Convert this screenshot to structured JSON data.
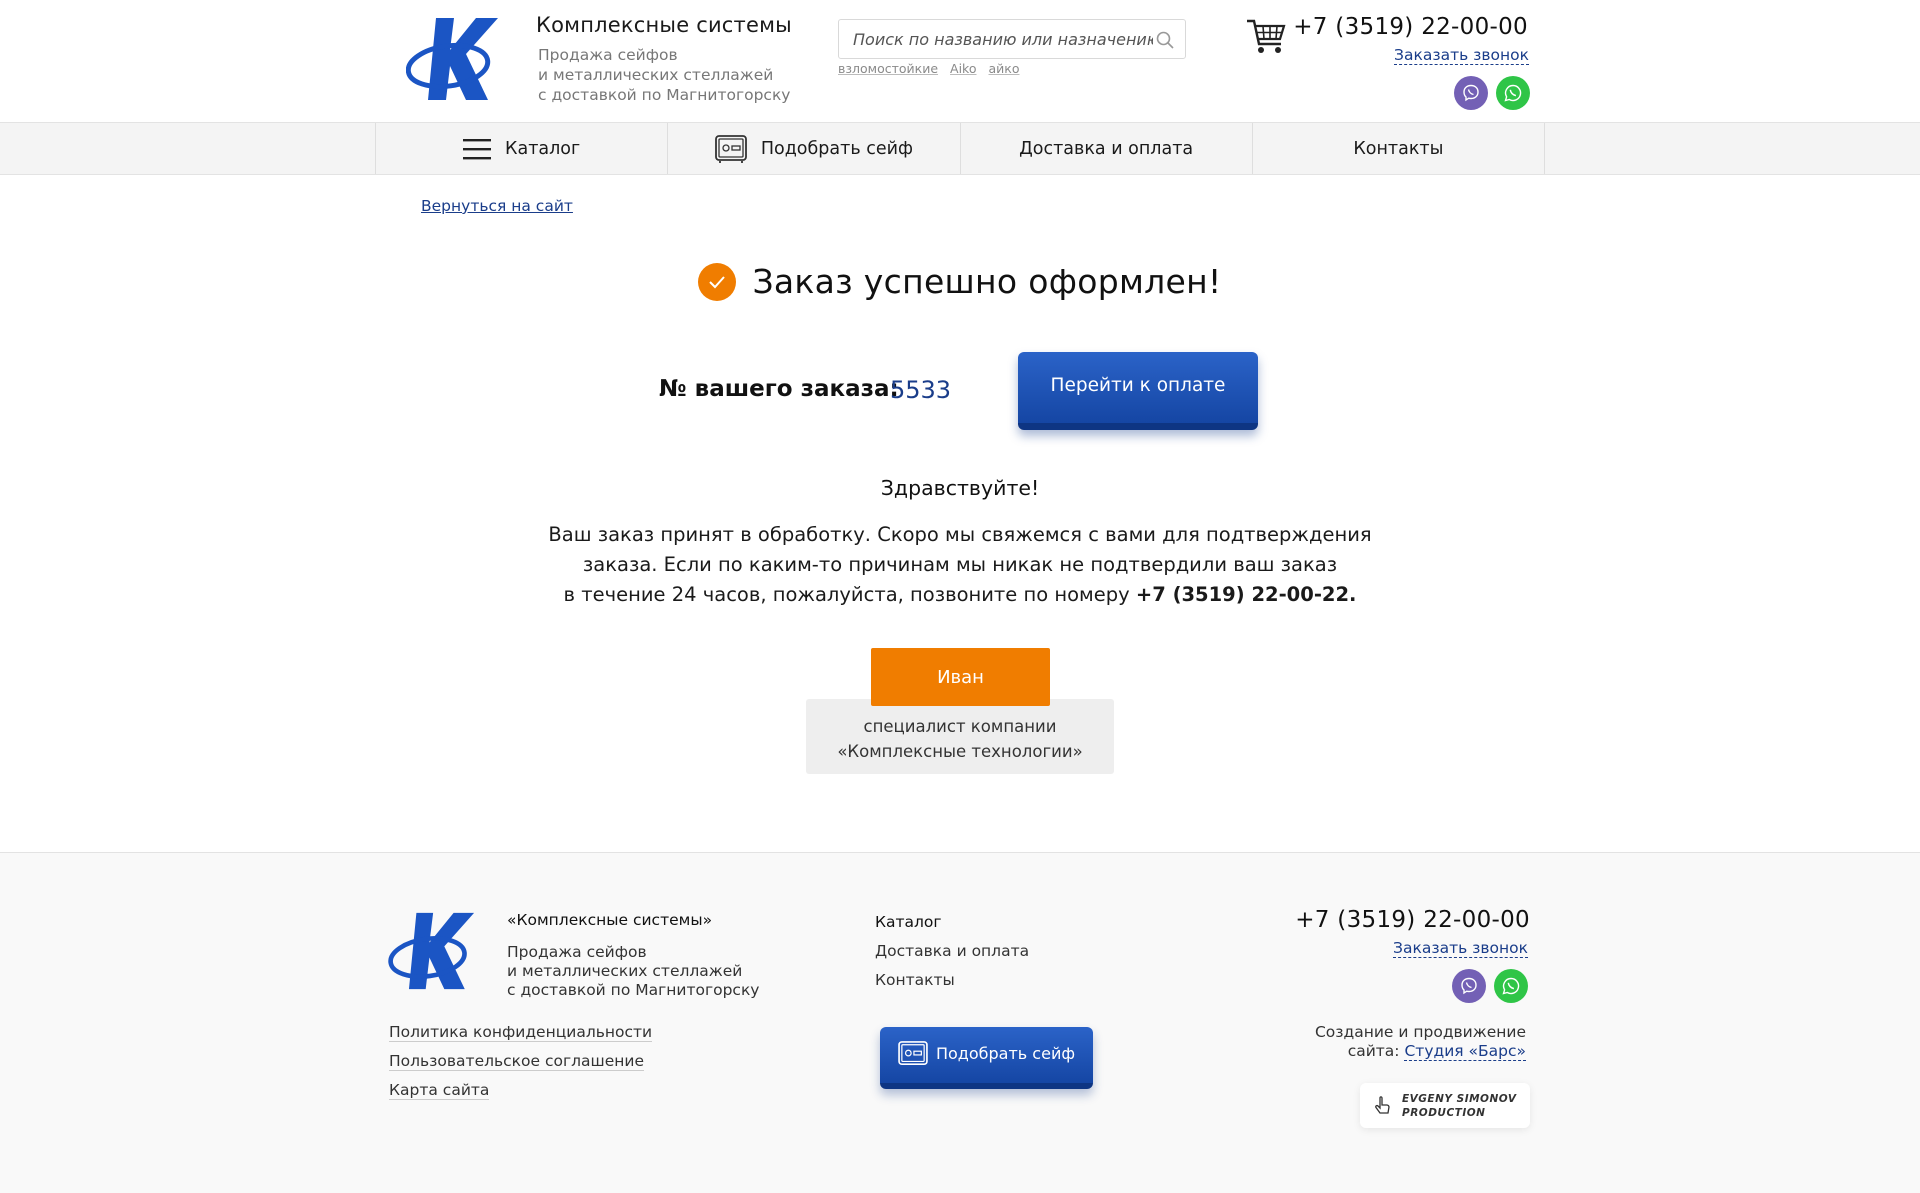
{
  "header": {
    "brand_title": "Комплексные системы",
    "brand_sub": [
      "Продажа сейфов",
      "и металлических стеллажей",
      "с доставкой по Магнитогорску"
    ],
    "search_placeholder": "Поиск по названию или назначению",
    "search_hints": [
      "взломостойкие",
      "Aiko",
      "айко"
    ],
    "phone": "+7 (3519) 22-00-00",
    "callback": "Заказать звонок",
    "icons": {
      "cart": "cart-icon",
      "search": "search-icon",
      "viber": "viber-icon",
      "whatsapp": "whatsapp-icon"
    }
  },
  "nav": {
    "items": [
      {
        "label": "Каталог",
        "icon": "menu-icon"
      },
      {
        "label": "Подобрать сейф",
        "icon": "safe-icon"
      },
      {
        "label": "Доставка и оплата",
        "icon": ""
      },
      {
        "label": "Контакты",
        "icon": ""
      }
    ]
  },
  "main": {
    "back_link": "Вернуться на сайт",
    "success_title": "Заказ успешно оформлен!",
    "order_label": "№ вашего заказа:",
    "order_number": "5533",
    "pay_button": "Перейти к оплате",
    "greeting": "Здравствуйте!",
    "info_lines": [
      "Ваш заказ принят в обработку. Скоро мы свяжемся с вами для подтверждения",
      "заказа. Если по каким-то причинам мы никак не подтвердили ваш заказ",
      "в течение 24 часов, пожалуйста, позвоните по номеру "
    ],
    "info_phone": "+7 (3519) 22-00-22.",
    "manager_name": "Иван",
    "manager_desc": [
      "специалист компании",
      "«Комплексные технологии»"
    ]
  },
  "footer": {
    "brand": "«Комплексные системы»",
    "brand_sub": [
      "Продажа сейфов",
      "и металлических стеллажей",
      "с доставкой по Магнитогорску"
    ],
    "links": [
      "Политика конфиденциальности",
      "Пользовательское соглашение",
      "Карта сайта"
    ],
    "nav": [
      "Каталог",
      "Доставка и оплата",
      "Контакты"
    ],
    "safe_button": "Подобрать сейф",
    "phone": "+7 (3519) 22-00-00",
    "callback": "Заказать звонок",
    "dev_text_1": "Создание и продвижение",
    "dev_text_2": "сайта: ",
    "dev_link": "Студия «Барс»",
    "studio_lines": [
      "EVGENY SIMONOV",
      "PRODUCTION"
    ]
  },
  "colors": {
    "accent_blue": "#1a3d8a",
    "button_blue": "#1b4fb3",
    "orange": "#f07d00",
    "viber": "#7360b5",
    "whatsapp": "#2fc547"
  }
}
